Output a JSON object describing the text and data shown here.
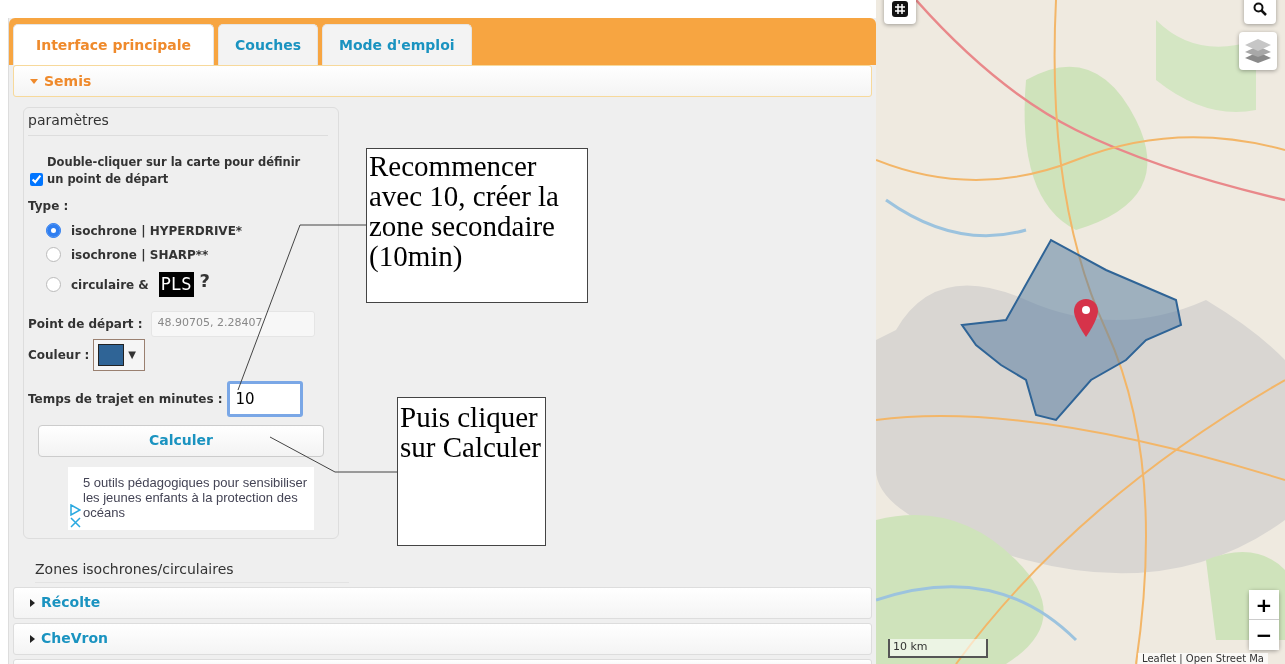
{
  "tabs": [
    {
      "label": "Interface principale",
      "selected": true
    },
    {
      "label": "Couches",
      "selected": false
    },
    {
      "label": "Mode d'emploi",
      "selected": false
    }
  ],
  "sections": [
    {
      "title": "Semis",
      "expanded": true
    },
    {
      "title": "Récolte",
      "expanded": false
    },
    {
      "title": "CheVron",
      "expanded": false
    }
  ],
  "parameters": {
    "legend": "paramètres",
    "checkbox": {
      "label": "Double-cliquer sur la carte pour définir un point de départ",
      "checked": true
    },
    "type_label": "Type :",
    "radios": [
      {
        "label": "isochrone | HYPERDRIVE*",
        "selected": true,
        "kind": "plain"
      },
      {
        "label": "isochrone | SHARP**",
        "selected": false,
        "kind": "plain"
      },
      {
        "label": "circulaire &",
        "selected": false,
        "kind": "badge",
        "badge": "PLS",
        "help": "?"
      }
    ],
    "start_point": {
      "label": "Point de départ :",
      "value": "48.90705, 2.28407"
    },
    "color": {
      "label": "Couleur :",
      "color": "#2f6496",
      "caret": "▼"
    },
    "travel_time": {
      "label": "Temps de trajet en minutes :",
      "value": "10",
      "focused": true
    },
    "button": "Calculer",
    "ad": {
      "text": "5 outils pédagogiques pour sensibiliser les jeunes enfants à la protection des océans"
    }
  },
  "zones_legend": "Zones isochrones/circulaires",
  "map": {
    "scale": "10 km",
    "attribution": "Leaflet | Open Street Ma",
    "zoom_in": "+",
    "zoom_out": "−"
  },
  "annotations": [
    {
      "text": "Recommencer avec 10, créer la zone secondaire (10min)"
    },
    {
      "text": "Puis cliquer sur Calculer"
    }
  ]
}
